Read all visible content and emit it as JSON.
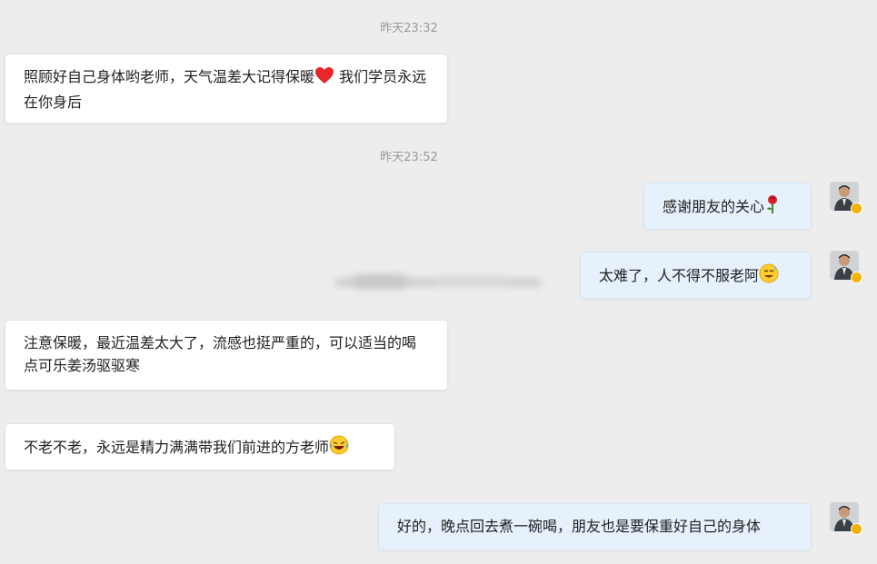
{
  "timestamps": [
    "昨天23:32",
    "昨天23:52"
  ],
  "messages": [
    {
      "text": "照顾好自己身体哟老师，天气温差大记得保暖",
      "emoji": "heart",
      "text2": " 我们学员永远在你身后"
    },
    {
      "text": "感谢朋友的关心",
      "emoji": "rose"
    },
    {
      "text": "太难了，人不得不服老阿",
      "emoji": "sweat-smile"
    },
    {
      "text": "注意保暖，最近温差太大了，流感也挺严重的，可以适当的喝点可乐姜汤驱驱寒"
    },
    {
      "text": "不老不老，永远是精力满满带我们前进的方老师",
      "emoji": "laugh-cry"
    },
    {
      "text": "好的，晚点回去煮一碗喝，朋友也是要保重好自己的身体"
    }
  ],
  "colors": {
    "background": "#ededed",
    "incoming_bubble": "#ffffff",
    "outgoing_bubble": "#e6f1fc",
    "verified_badge": "#f0b400"
  }
}
